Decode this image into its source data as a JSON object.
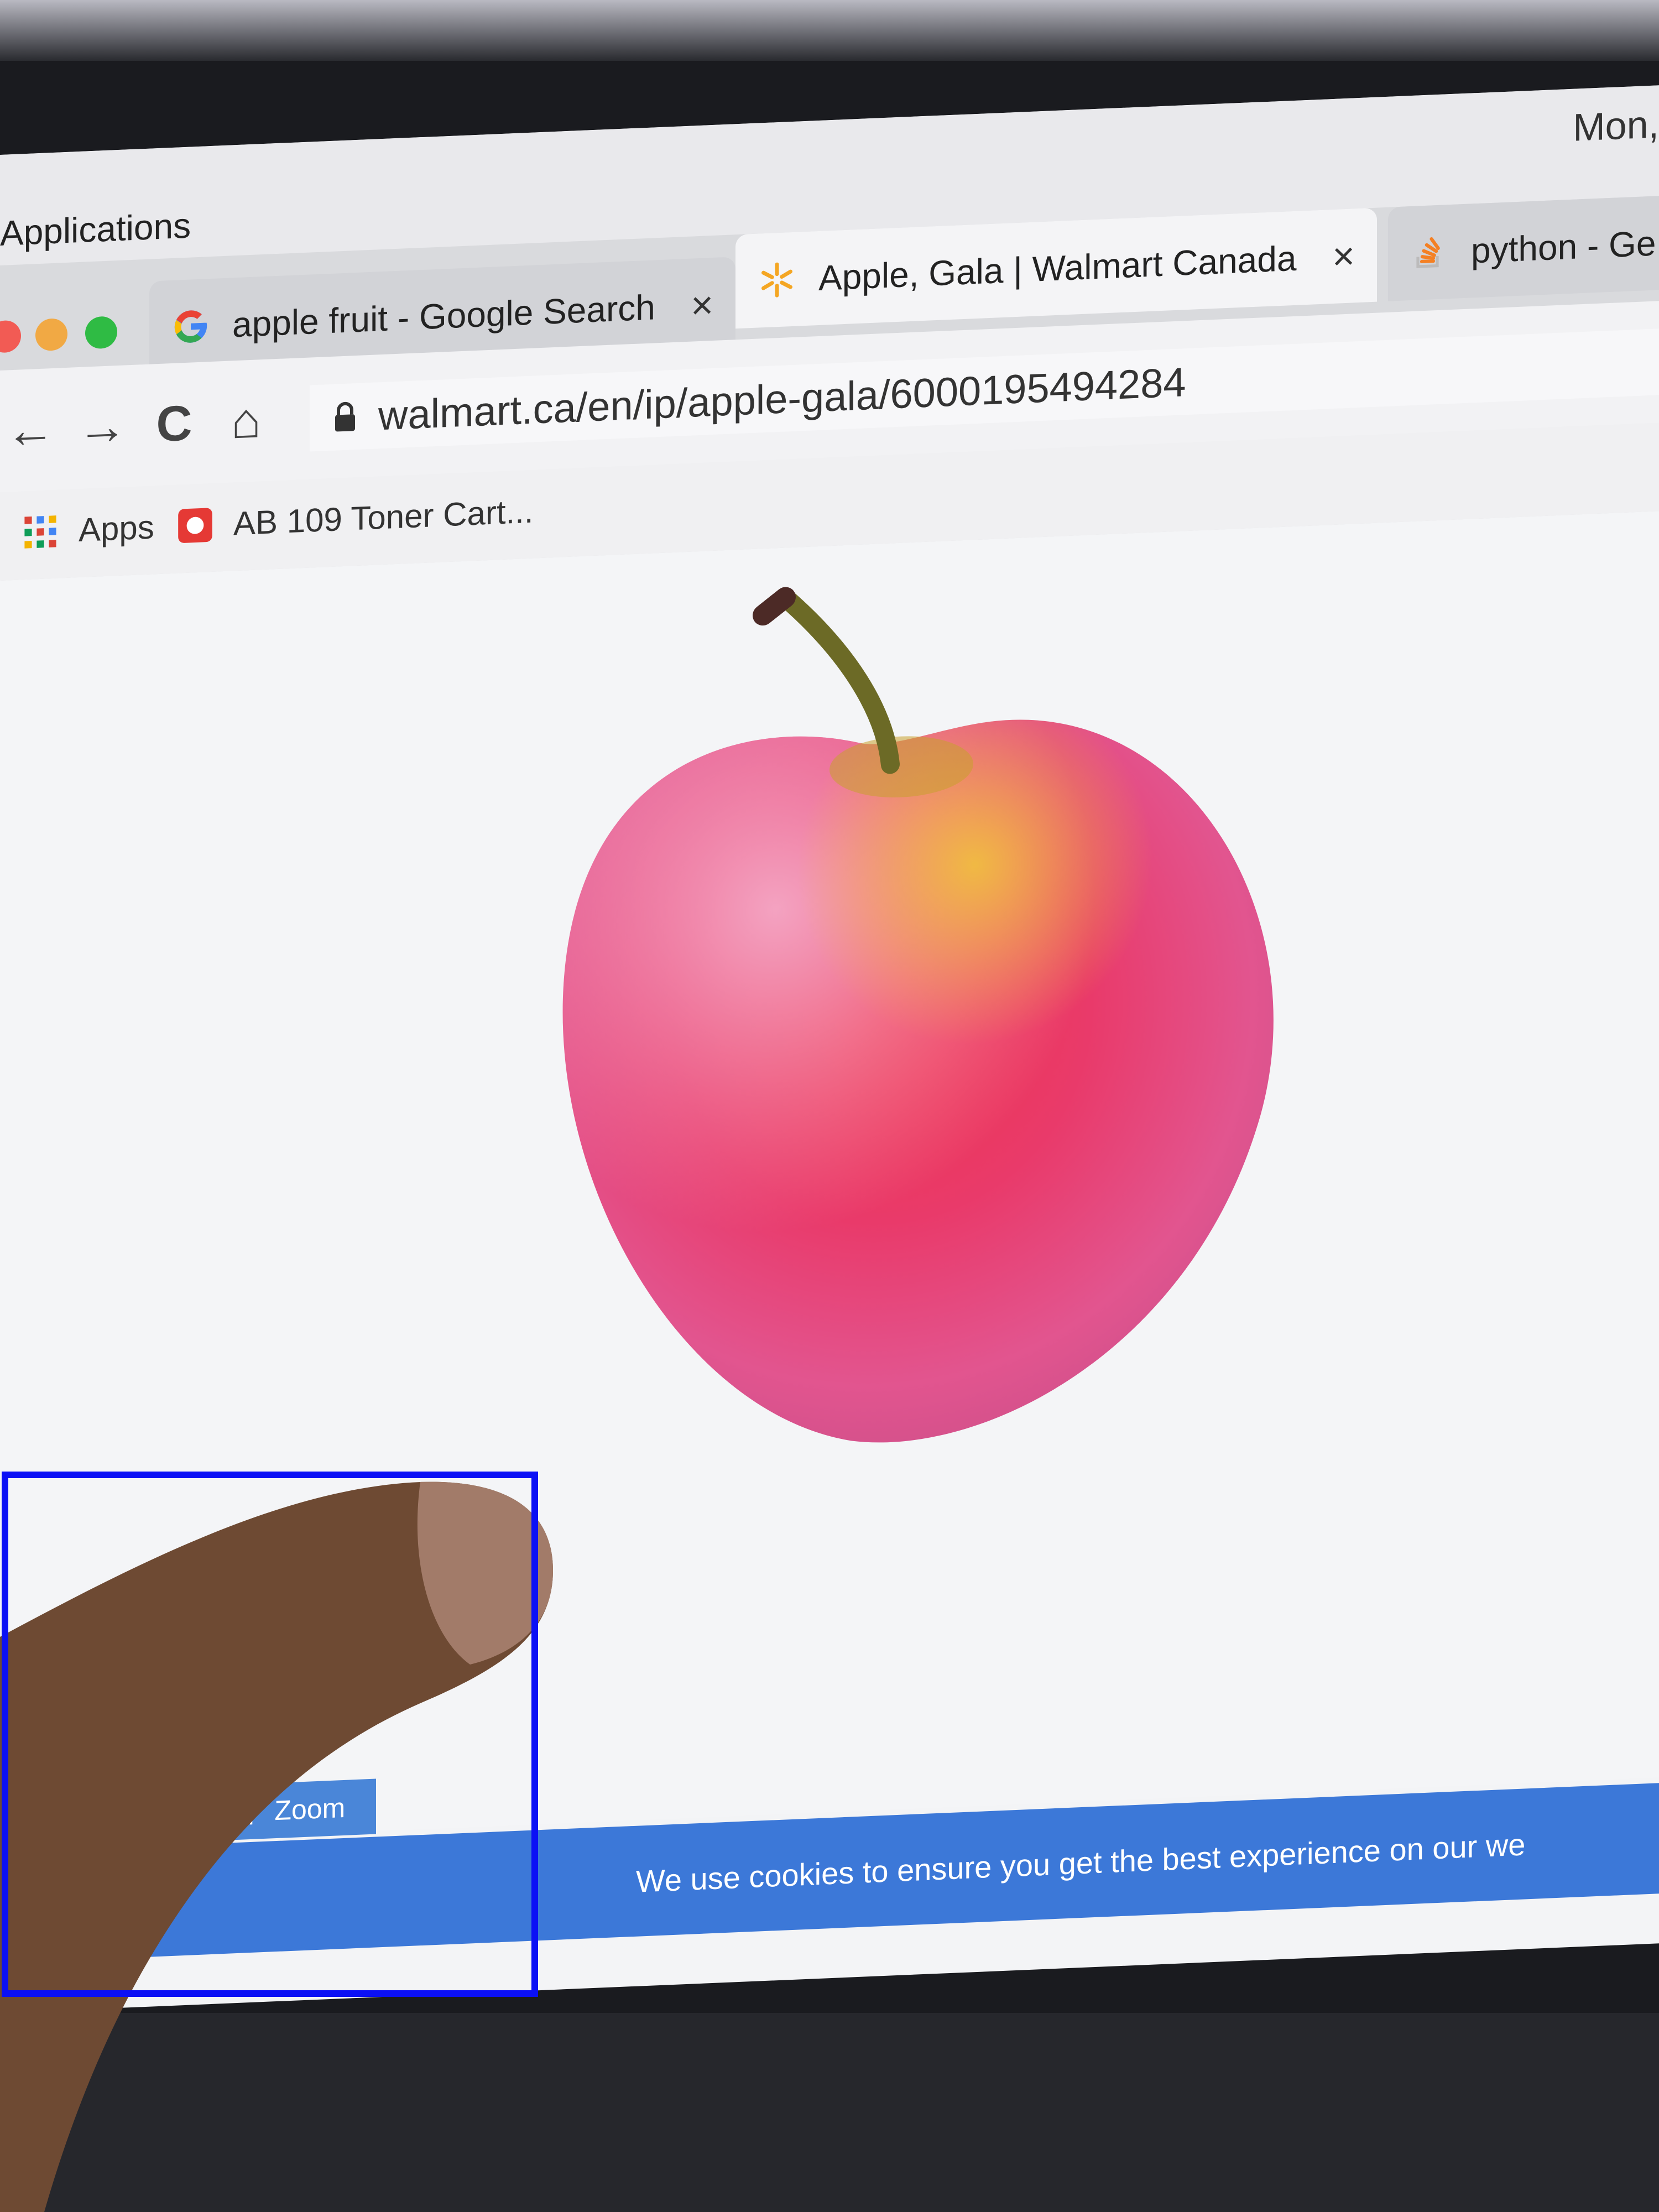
{
  "os": {
    "app_menu": "Applications",
    "clock": "Mon,"
  },
  "tabs": [
    {
      "title": "apple fruit - Google Search",
      "close": "×",
      "icon": "google-g-icon",
      "active": false
    },
    {
      "title": "Apple, Gala | Walmart Canada",
      "close": "×",
      "icon": "walmart-spark-icon",
      "active": true
    },
    {
      "title": "python - Ge",
      "icon": "stackoverflow-icon",
      "active": false
    }
  ],
  "window_controls": {
    "close": "#f25b54",
    "minimize": "#f1a944",
    "maximize": "#2fbb44"
  },
  "toolbar": {
    "back": "←",
    "forward": "→",
    "reload": "C",
    "home": "⌂",
    "url": "walmart.ca/en/ip/apple-gala/6000195494284"
  },
  "bookmarks": [
    {
      "label": "Apps",
      "icon": "apps-grid-icon"
    },
    {
      "label": "AB 109 Toner Cart...",
      "icon": "bookmark-favicon-icon"
    }
  ],
  "product": {
    "image_icon": "apple-product-image",
    "zoom_label": "Zoom"
  },
  "cookie_banner": {
    "text": "We use cookies to ensure you get the best experience on our we"
  },
  "colors": {
    "cookie_bar": "#3c78d8",
    "annotation_box": "#0b10f5",
    "walmart_spark": "#f4a623"
  }
}
